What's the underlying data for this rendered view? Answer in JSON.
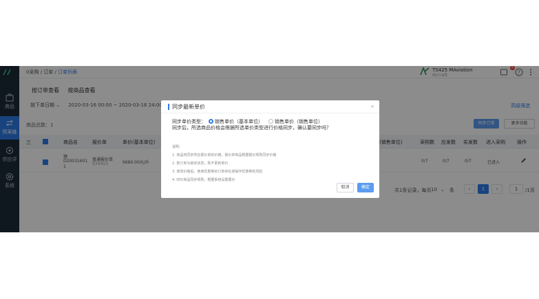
{
  "sidebar": {
    "items": [
      {
        "label": "商品",
        "icon": "product-icon"
      },
      {
        "label": "供采链",
        "icon": "supply-chain-icon",
        "active": true
      },
      {
        "label": "供应评",
        "icon": "review-icon"
      },
      {
        "label": "系统",
        "icon": "settings-icon"
      }
    ]
  },
  "topbar": {
    "crumb_home": "0采购",
    "crumb_sep": " / ",
    "crumb_mid": "订单",
    "crumb_current": "订单列表",
    "company_name": "TS425 MAviation",
    "company_sub": "Aircraft",
    "badge": "6"
  },
  "tabs": [
    "按订单查看",
    "按商品查看"
  ],
  "filters": {
    "date_type": "按下单日期",
    "date_range": "2020-03-16 00:00 ~ 2020-03-16 24:00",
    "more_link": "高级筛选"
  },
  "toolbar": {
    "count": "商品总数：1",
    "sync_button": "同步订单",
    "more_button": "更多功能"
  },
  "table": {
    "headers": [
      "商品名",
      "报价单",
      "单价(基本单位)",
      "税(销售单位)",
      "采购数",
      "应发数",
      "实发数",
      "进入采购",
      "操作"
    ],
    "row": {
      "name": "猪",
      "code": "D20031601",
      "code2": "1",
      "quote": "普通报价单",
      "quote_code": "S34453",
      "price": "9680.00元/斤",
      "purchase": "0/7",
      "due": "0/7",
      "actual": "0/7",
      "status": "已进入"
    }
  },
  "pagination": {
    "summary": "共1条记录，每页",
    "per_page": "10",
    "unit": "条",
    "current": "1",
    "jump": "1",
    "total_pages": "/1页"
  },
  "dialog": {
    "title": "同步最新单价",
    "type_label": "同步单价类型：",
    "option_base": "销售单价（基本单位）",
    "option_sale": "销售单价（销售单位）",
    "desc": "同步后，所选商品价格会根据所选单价类型进行价格同步，确认要同步吗？",
    "notes_title": "说明：",
    "notes": [
      "1. 商品将同步所在报价单的价格，报价单商品根据报价规则同步价格",
      "2. 若订单为锁定状态，则不更新单价",
      "3. 修改价格后，使用优惠券的订单存在误操作优惠券的风险",
      "4. 时价商品同步规则，根据系统设置展示"
    ],
    "cancel": "取消",
    "ok": "确定"
  },
  "colors": {
    "primary": "#2c7be5",
    "sidebar": "#1d2a3a",
    "button": "#5c9cef"
  }
}
